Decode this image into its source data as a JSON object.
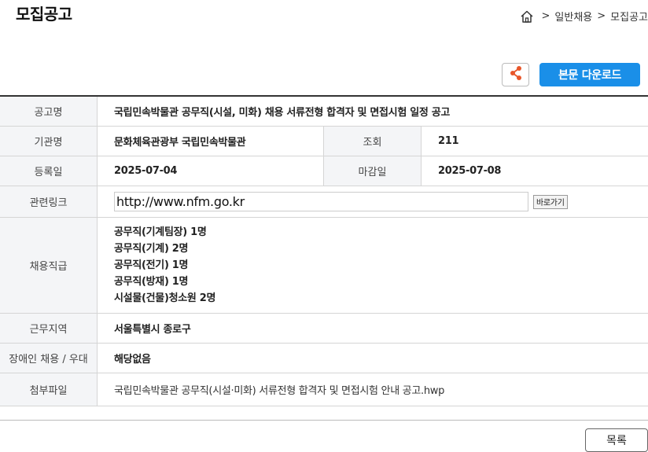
{
  "page": {
    "title": "모집공고"
  },
  "breadcrumb": {
    "sep1": ">",
    "item1": "일반채용",
    "sep2": ">",
    "item2": "모집공고"
  },
  "toolbar": {
    "download_label": "본문 다운로드"
  },
  "table": {
    "title_label": "공고명",
    "title_value": "국립민속박물관 공무직(시설, 미화) 채용 서류전형 합격자 및 면접시험 일정 공고",
    "org_label": "기관명",
    "org_value": "문화체육관광부 국립민속박물관",
    "views_label": "조회",
    "views_value": "211",
    "reg_label": "등록일",
    "reg_value": "2025-07-04",
    "deadline_label": "마감일",
    "deadline_value": "2025-07-08",
    "link_label": "관련링크",
    "link_value": "http://www.nfm.go.kr",
    "go_label": "바로가기",
    "positions_label": "채용직급",
    "positions": [
      "공무직(기계팀장) 1명",
      "공무직(기계) 2명",
      "공무직(전기) 1명",
      "공무직(방재) 1명",
      "시설물(건물)청소원 2명"
    ],
    "location_label": "근무지역",
    "location_value": "서울특별시 종로구",
    "disability_label": "장애인 채용 / 우대",
    "disability_value": "해당없음",
    "attach_label": "첨부파일",
    "attach_value": "국립민속박물관 공무직(시설·미화) 서류전형 합격자 및 면접시험 안내 공고.hwp"
  },
  "footer": {
    "list_label": "목록"
  }
}
